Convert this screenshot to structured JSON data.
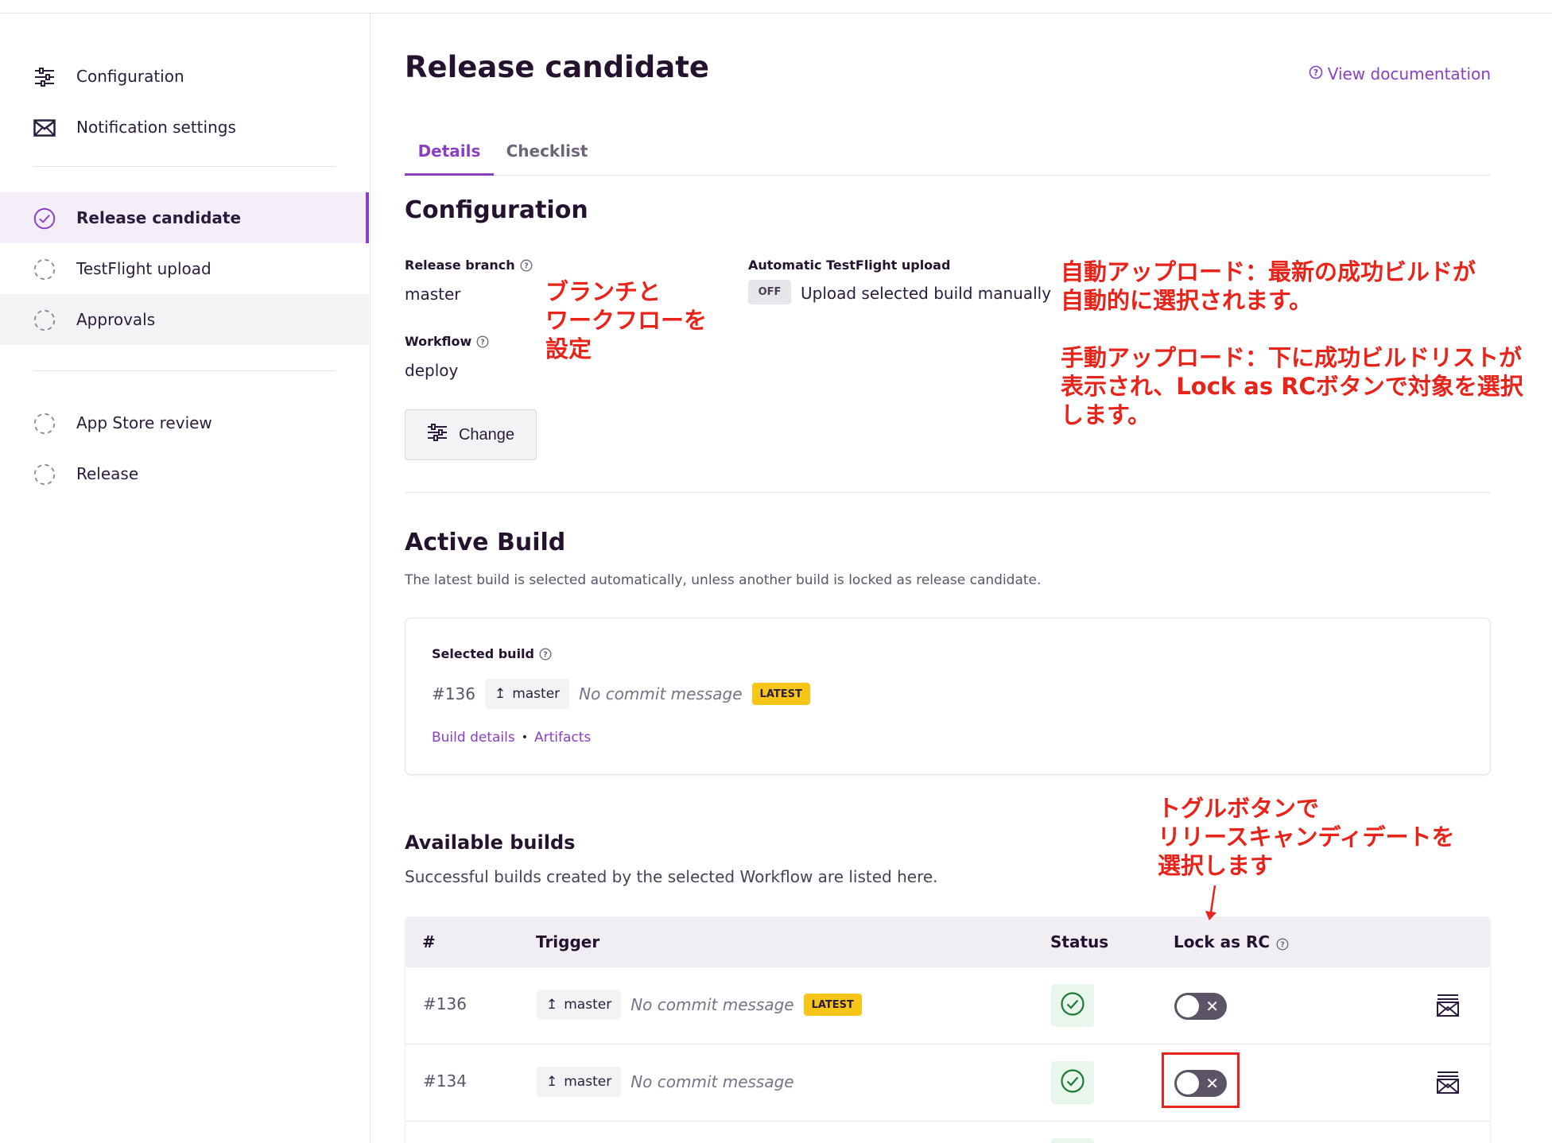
{
  "sidebar": {
    "items": [
      {
        "label": "Configuration",
        "icon": "sliders-icon"
      },
      {
        "label": "Notification settings",
        "icon": "mail-icon"
      },
      {
        "label": "Release candidate",
        "icon": "check-circle-icon"
      },
      {
        "label": "TestFlight upload",
        "icon": "dashed-circle-icon"
      },
      {
        "label": "Approvals",
        "icon": "dashed-circle-icon"
      },
      {
        "label": "App Store review",
        "icon": "dashed-circle-icon"
      },
      {
        "label": "Release",
        "icon": "dashed-circle-icon"
      }
    ]
  },
  "header": {
    "title": "Release candidate",
    "view_doc": "View documentation"
  },
  "tabs": [
    {
      "label": "Details"
    },
    {
      "label": "Checklist"
    }
  ],
  "configuration": {
    "title": "Configuration",
    "release_branch_label": "Release branch",
    "release_branch_value": "master",
    "workflow_label": "Workflow",
    "workflow_value": "deploy",
    "auto_upload_label": "Automatic TestFlight upload",
    "auto_upload_badge": "OFF",
    "auto_upload_value": "Upload selected build manually",
    "change_label": "Change"
  },
  "active_build": {
    "title": "Active Build",
    "description": "The latest build is selected automatically, unless another build is locked as release candidate.",
    "selected_label": "Selected build",
    "number": "#136",
    "branch": "master",
    "commit": "No commit message",
    "badge": "LATEST",
    "build_details": "Build details",
    "separator": "•",
    "artifacts": "Artifacts"
  },
  "available_builds": {
    "title": "Available builds",
    "description": "Successful builds created by the selected Workflow are listed here.",
    "columns": {
      "number": "#",
      "trigger": "Trigger",
      "status": "Status",
      "lock": "Lock as RC"
    },
    "rows": [
      {
        "number": "#136",
        "branch": "master",
        "commit": "No commit message",
        "badge": "LATEST"
      },
      {
        "number": "#134",
        "branch": "master",
        "commit": "No commit message",
        "badge": ""
      }
    ]
  },
  "annotations": {
    "branch_workflow": "ブランチと\nワークフローを\n設定",
    "auto_upload": "自動アップロード：最新の成功ビルドが\n自動的に選択されます。",
    "manual_upload": "手動アップロード：下に成功ビルドリストが\n表示され、Lock as RCボタンで対象を選択\nします。",
    "toggle_hint": "トグルボタンで\nリリースキャンディデートを\n選択します"
  },
  "colors": {
    "accent": "#8a3fc2",
    "annotation": "#e8231a",
    "latest_badge": "#f5c518",
    "success": "#1e7a3a"
  }
}
